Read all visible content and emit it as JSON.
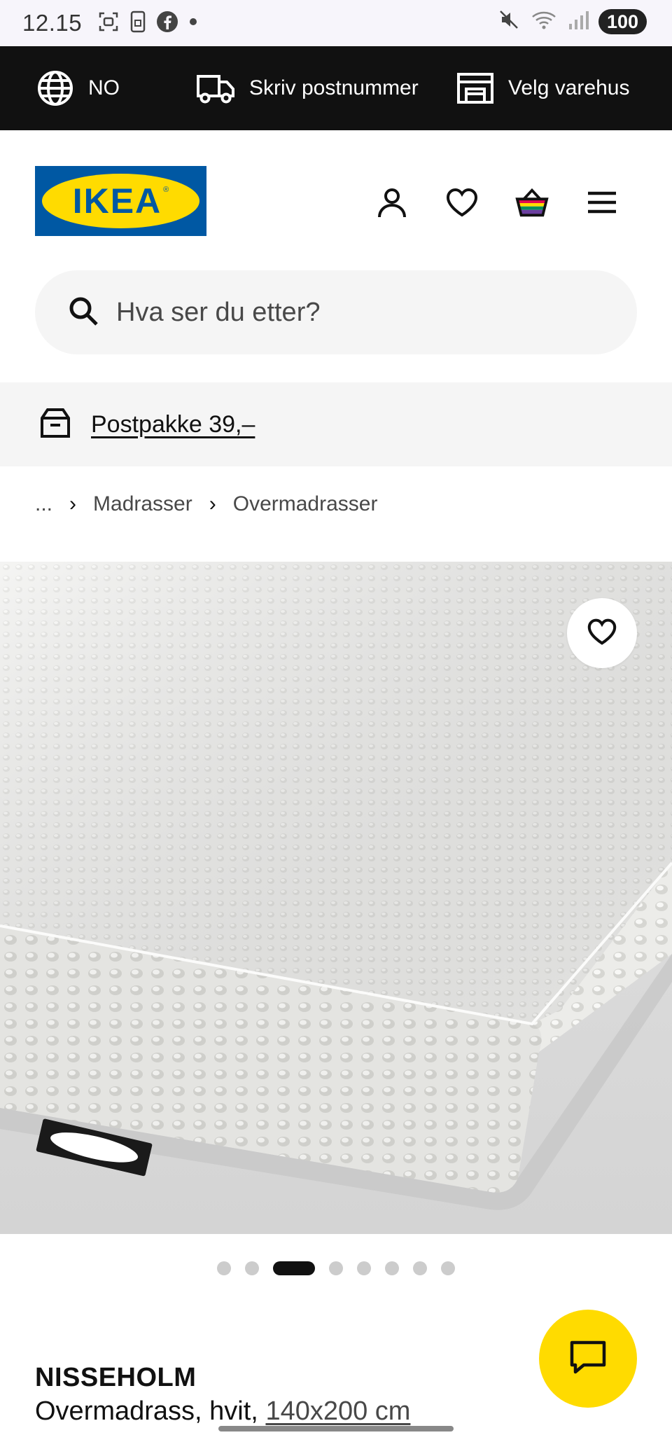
{
  "status_bar": {
    "time": "12.15",
    "battery": "100",
    "icons": [
      "screenshot-icon",
      "sim-icon",
      "facebook-icon",
      "dot-icon",
      "mute-icon",
      "wifi-icon",
      "signal-icon"
    ]
  },
  "top_bar": {
    "language": "NO",
    "delivery": "Skriv postnummer",
    "store": "Velg varehus"
  },
  "header": {
    "logo_text": "IKEA",
    "logo_reg": "®",
    "icons": [
      "account-icon",
      "heart-icon",
      "cart-icon",
      "menu-icon"
    ]
  },
  "search": {
    "placeholder": "Hva ser du etter?"
  },
  "promo": {
    "label": "Postpakke 39,–"
  },
  "breadcrumb": {
    "ellipsis": "...",
    "items": [
      "Madrasser",
      "Overmadrasser"
    ]
  },
  "gallery": {
    "image_count": 8,
    "active_index": 2
  },
  "product": {
    "name": "NISSEHOLM",
    "description": "Overmadrass, hvit,",
    "size": "140x200 cm"
  },
  "colors": {
    "ikea_blue": "#0058a3",
    "ikea_yellow": "#ffdb00",
    "top_bar": "#111111",
    "chat_button": "#ffdb00"
  }
}
